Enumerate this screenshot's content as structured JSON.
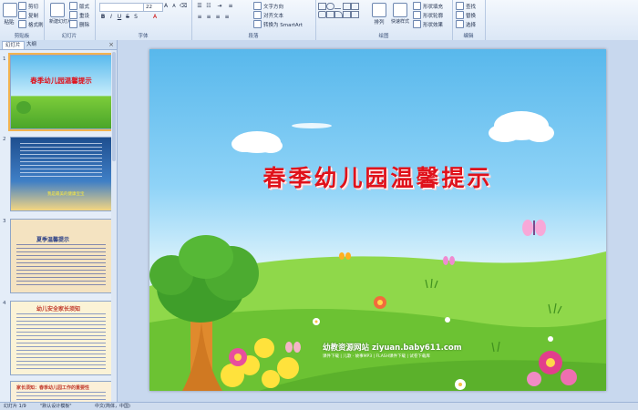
{
  "ribbon": {
    "clipboard": {
      "paste": "粘贴",
      "cut": "剪切",
      "copy": "复制",
      "format_painter": "格式刷",
      "label": "剪贴板"
    },
    "slides": {
      "new_slide": "新建幻灯片",
      "layout": "版式",
      "reset": "重设",
      "delete": "删除",
      "label": "幻灯片"
    },
    "font": {
      "size": "22",
      "label": "字体"
    },
    "paragraph": {
      "text_direction": "文字方向",
      "align_text": "对齐文本",
      "smartart": "转换为 SmartArt",
      "label": "段落"
    },
    "drawing": {
      "arrange": "排列",
      "quick_styles": "快速样式",
      "shape_fill": "形状填充",
      "shape_outline": "形状轮廓",
      "shape_effects": "形状效果",
      "label": "绘图"
    },
    "editing": {
      "find": "查找",
      "replace": "替换",
      "select": "选择",
      "label": "编辑"
    }
  },
  "panel": {
    "tabs": [
      "幻灯片",
      "大纲"
    ],
    "close": "×",
    "thumbnails": [
      {
        "num": "1",
        "title": "春季幼儿园温馨提示"
      },
      {
        "num": "2",
        "caption": "我是最美的健康宝宝"
      },
      {
        "num": "3",
        "title": "夏季温馨提示"
      },
      {
        "num": "4",
        "title": "幼儿安全家长须知"
      },
      {
        "num": "5",
        "title": "家长须知：春季幼儿园工作的重要性"
      }
    ]
  },
  "slide": {
    "title": "春季幼儿园温馨提示",
    "site_name": "幼教资源网站 ziyuan.baby611.com",
    "site_sub": "课件下载 | 儿歌 · 故事MP3 | FLASH课件下载 | 试卷下载库"
  },
  "status": {
    "slide_count": "幻灯片 1/9",
    "theme": "\"默认设计模板\"",
    "language": "中文(简体，中国)"
  },
  "colors": {
    "title_red": "#e0121b",
    "ribbon_bg": "#dbe7f6",
    "selected_outline": "#f3b34f"
  }
}
